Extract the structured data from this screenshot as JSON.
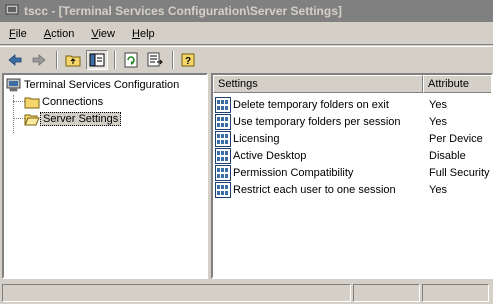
{
  "window": {
    "title": "tscc - [Terminal Services Configuration\\Server Settings]"
  },
  "menu": {
    "items": [
      "File",
      "Action",
      "View",
      "Help"
    ]
  },
  "toolbar": {
    "buttons": [
      "back-icon",
      "forward-icon",
      "up-folder-icon",
      "show-hide-tree-icon",
      "refresh-icon",
      "export-list-icon",
      "help-icon"
    ]
  },
  "tree": {
    "root": "Terminal Services Configuration",
    "children": [
      "Connections",
      "Server Settings"
    ],
    "selected": "Server Settings"
  },
  "list": {
    "columns": [
      "Settings",
      "Attribute"
    ],
    "rows": [
      {
        "setting": "Delete temporary folders on exit",
        "attribute": "Yes"
      },
      {
        "setting": "Use temporary folders per session",
        "attribute": "Yes"
      },
      {
        "setting": "Licensing",
        "attribute": "Per Device"
      },
      {
        "setting": "Active Desktop",
        "attribute": "Disable"
      },
      {
        "setting": "Permission Compatibility",
        "attribute": "Full Security"
      },
      {
        "setting": "Restrict each user to one session",
        "attribute": "Yes"
      }
    ]
  },
  "colors": {
    "face": "#d4d0c8",
    "shadow": "#808080",
    "highlight": "#ffffff",
    "title_inactive": "#808080"
  }
}
